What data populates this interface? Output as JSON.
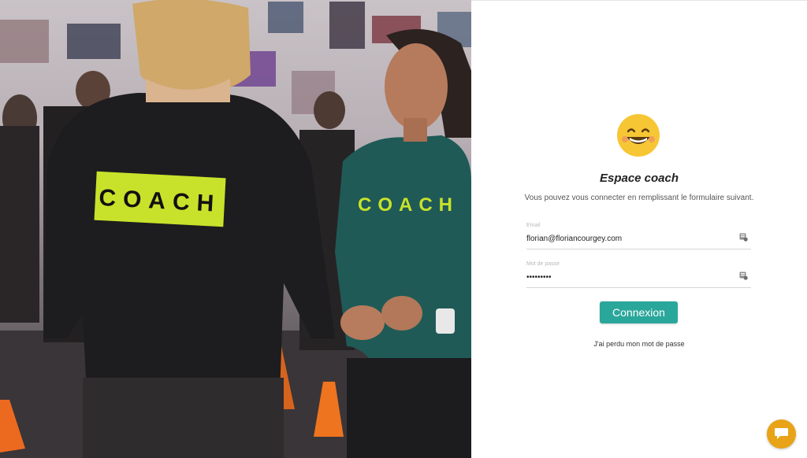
{
  "photo": {
    "shirt_front_text": "COACH",
    "shirt_back_text": "COACH",
    "alt_description_icon": "photo-two-coaches"
  },
  "login": {
    "logo_icon": "smiley-face-icon",
    "title": "Espace coach",
    "subtitle": "Vous pouvez vous connecter en remplissant le formulaire suivant.",
    "email": {
      "label": "Email",
      "value": "florian@floriancourgey.com",
      "icon": "password-manager-icon"
    },
    "password": {
      "label": "Mot de passe",
      "value": "•••••••••",
      "icon": "password-manager-icon"
    },
    "submit_label": "Connexion",
    "lost_password_link": "J'ai perdu mon mot de passe"
  },
  "chat": {
    "icon": "chat-bubble-icon"
  },
  "colors": {
    "accent": "#2aa79b",
    "chat": "#e8a317",
    "shirt_green": "#c8e22b",
    "shirt_teal": "#1f5a57"
  }
}
